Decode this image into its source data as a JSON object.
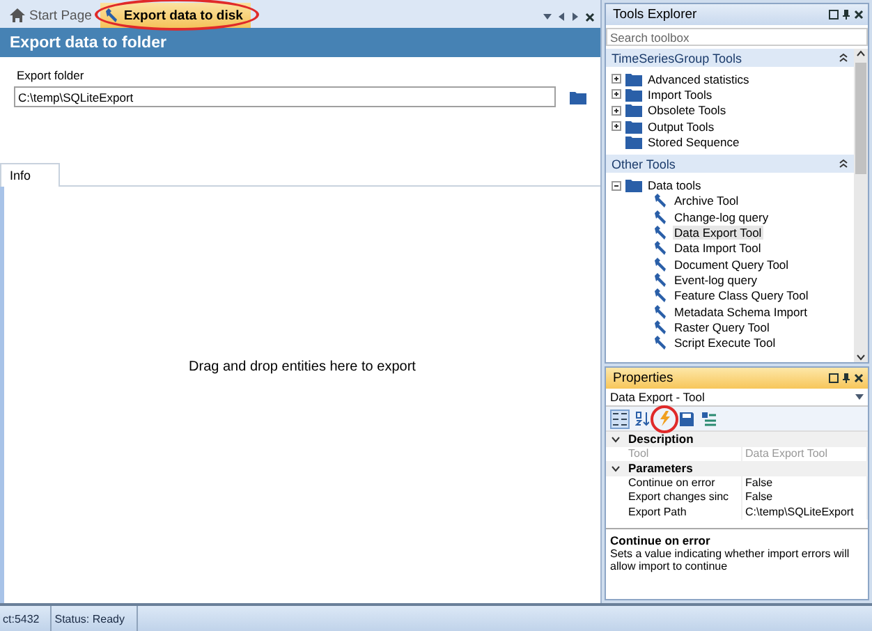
{
  "document_tabs": [
    {
      "label": "Start Page",
      "selected": false,
      "kind": "home",
      "annotated": false
    },
    {
      "label": "Export data to disk",
      "selected": true,
      "kind": "tool",
      "annotated": true
    }
  ],
  "editor": {
    "title": "Export data to folder",
    "folder_label": "Export folder",
    "folder_value": "C:\\temp\\SQLiteExport",
    "info_tabs": [
      {
        "label": "Info",
        "selected": true
      }
    ],
    "drop_message": "Drag and drop entities here to export"
  },
  "tools_explorer": {
    "title": "Tools Explorer",
    "search_placeholder": "Search toolbox",
    "groups": [
      {
        "title": "TimeSeriesGroup Tools",
        "items": [
          {
            "label": "Advanced statistics",
            "kind": "folder",
            "expanded": false,
            "selected": false
          },
          {
            "label": "Import Tools",
            "kind": "folder",
            "expanded": false,
            "selected": false
          },
          {
            "label": "Obsolete Tools",
            "kind": "folder",
            "expanded": false,
            "selected": false
          },
          {
            "label": "Output Tools",
            "kind": "folder",
            "expanded": false,
            "selected": false
          },
          {
            "label": "Stored Sequence",
            "kind": "leaf-folder",
            "selected": false
          }
        ]
      },
      {
        "title": "Other Tools",
        "items": [
          {
            "label": "Data tools",
            "kind": "folder",
            "expanded": true,
            "selected": false,
            "children": [
              {
                "label": "Archive Tool",
                "kind": "tool",
                "selected": false
              },
              {
                "label": "Change-log query",
                "kind": "tool",
                "selected": false
              },
              {
                "label": "Data Export Tool",
                "kind": "tool",
                "selected": true
              },
              {
                "label": "Data Import Tool",
                "kind": "tool",
                "selected": false
              },
              {
                "label": "Document Query Tool",
                "kind": "tool",
                "selected": false
              },
              {
                "label": "Event-log query",
                "kind": "tool",
                "selected": false
              },
              {
                "label": "Feature Class Query Tool",
                "kind": "tool",
                "selected": false
              },
              {
                "label": "Metadata Schema Import",
                "kind": "tool",
                "selected": false
              },
              {
                "label": "Raster Query Tool",
                "kind": "tool",
                "selected": false
              },
              {
                "label": "Script Execute Tool",
                "kind": "tool",
                "selected": false
              }
            ]
          }
        ]
      }
    ]
  },
  "properties": {
    "title": "Properties",
    "object": "Data Export - Tool",
    "toolbar": [
      {
        "kind": "categorized",
        "selected": true,
        "annotated": false
      },
      {
        "kind": "alphabetical",
        "selected": false,
        "annotated": false
      },
      {
        "kind": "events",
        "selected": false,
        "annotated": true
      },
      {
        "kind": "save",
        "selected": false,
        "annotated": false
      },
      {
        "kind": "settings",
        "selected": false,
        "annotated": false
      }
    ],
    "categories": [
      {
        "name": "Description",
        "expanded": true,
        "rows": [
          {
            "name": "Tool",
            "value": "Data Export Tool",
            "disabled": true
          }
        ]
      },
      {
        "name": "Parameters",
        "expanded": true,
        "rows": [
          {
            "name": "Continue on error",
            "value": "False",
            "disabled": false
          },
          {
            "name": "Export changes sinc",
            "value": "False",
            "disabled": false
          },
          {
            "name": "Export Path",
            "value": "C:\\temp\\SQLiteExport",
            "disabled": false
          }
        ]
      }
    ],
    "help_title": "Continue on error",
    "help_text": "Sets a value indicating whether import errors will allow import to continue"
  },
  "status_bar": [
    "ct:5432",
    "Status: Ready"
  ]
}
